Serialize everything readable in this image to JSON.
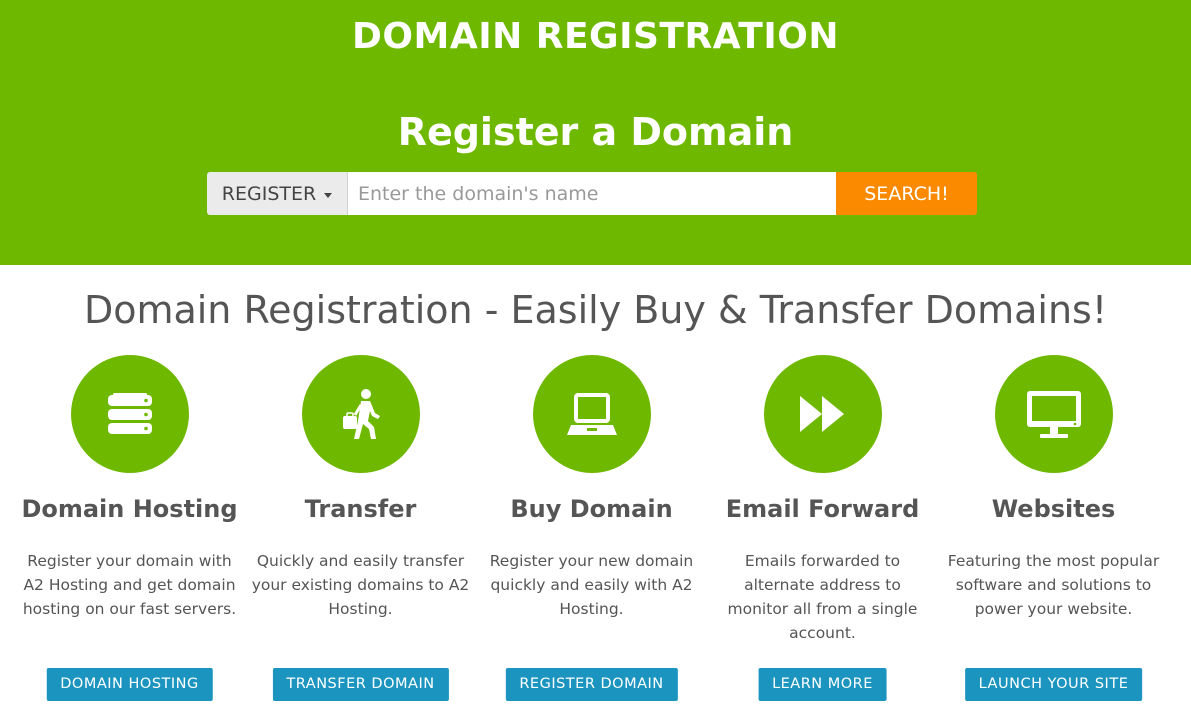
{
  "hero": {
    "title": "DOMAIN REGISTRATION",
    "subtitle": "Register a Domain"
  },
  "search": {
    "select_value": "REGISTER",
    "placeholder": "Enter the domain's name",
    "button_label": "SEARCH!"
  },
  "main": {
    "heading": "Domain Registration - Easily Buy & Transfer Domains!"
  },
  "features": [
    {
      "icon": "server-icon",
      "title": "Domain Hosting",
      "description": "Register your domain with A2 Hosting and get domain hosting on our fast servers.",
      "button": "DOMAIN HOSTING"
    },
    {
      "icon": "person-suitcase-icon",
      "title": "Transfer",
      "description": "Quickly and easily transfer your existing domains to A2 Hosting.",
      "button": "TRANSFER DOMAIN"
    },
    {
      "icon": "laptop-icon",
      "title": "Buy Domain",
      "description": "Register your new domain quickly and easily with A2 Hosting.",
      "button": "REGISTER DOMAIN"
    },
    {
      "icon": "fast-forward-icon",
      "title": "Email Forward",
      "description": "Emails forwarded to alternate address to monitor all from a single account.",
      "button": "LEARN MORE"
    },
    {
      "icon": "monitor-icon",
      "title": "Websites",
      "description": "Featuring the most popular software and solutions to power your website.",
      "button": "LAUNCH YOUR SITE"
    }
  ],
  "colors": {
    "brand_green": "#6fb800",
    "search_orange": "#fb8a00",
    "button_blue": "#1b95c0"
  }
}
